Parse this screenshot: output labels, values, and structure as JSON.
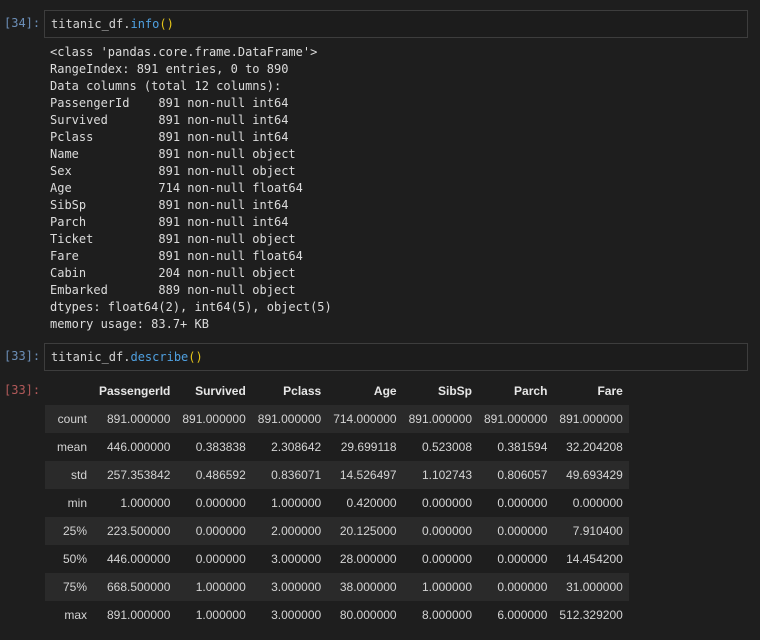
{
  "cells": [
    {
      "prompt": "[34]:",
      "code": {
        "object": "titanic_df",
        "method": "info",
        "args": "()"
      },
      "stdout": [
        "<class 'pandas.core.frame.DataFrame'>",
        "RangeIndex: 891 entries, 0 to 890",
        "Data columns (total 12 columns):",
        "PassengerId    891 non-null int64",
        "Survived       891 non-null int64",
        "Pclass         891 non-null int64",
        "Name           891 non-null object",
        "Sex            891 non-null object",
        "Age            714 non-null float64",
        "SibSp          891 non-null int64",
        "Parch          891 non-null int64",
        "Ticket         891 non-null object",
        "Fare           891 non-null float64",
        "Cabin          204 non-null object",
        "Embarked       889 non-null object",
        "dtypes: float64(2), int64(5), object(5)",
        "memory usage: 83.7+ KB"
      ]
    },
    {
      "prompt": "[33]:",
      "code": {
        "object": "titanic_df",
        "method": "describe",
        "args": "()"
      },
      "output_prompt": "[33]:"
    }
  ],
  "describe_table": {
    "columns": [
      "PassengerId",
      "Survived",
      "Pclass",
      "Age",
      "SibSp",
      "Parch",
      "Fare"
    ],
    "rows": [
      {
        "index": "count",
        "values": [
          "891.000000",
          "891.000000",
          "891.000000",
          "714.000000",
          "891.000000",
          "891.000000",
          "891.000000"
        ]
      },
      {
        "index": "mean",
        "values": [
          "446.000000",
          "0.383838",
          "2.308642",
          "29.699118",
          "0.523008",
          "0.381594",
          "32.204208"
        ]
      },
      {
        "index": "std",
        "values": [
          "257.353842",
          "0.486592",
          "0.836071",
          "14.526497",
          "1.102743",
          "0.806057",
          "49.693429"
        ]
      },
      {
        "index": "min",
        "values": [
          "1.000000",
          "0.000000",
          "1.000000",
          "0.420000",
          "0.000000",
          "0.000000",
          "0.000000"
        ]
      },
      {
        "index": "25%",
        "values": [
          "223.500000",
          "0.000000",
          "2.000000",
          "20.125000",
          "0.000000",
          "0.000000",
          "7.910400"
        ]
      },
      {
        "index": "50%",
        "values": [
          "446.000000",
          "0.000000",
          "3.000000",
          "28.000000",
          "0.000000",
          "0.000000",
          "14.454200"
        ]
      },
      {
        "index": "75%",
        "values": [
          "668.500000",
          "1.000000",
          "3.000000",
          "38.000000",
          "1.000000",
          "0.000000",
          "31.000000"
        ]
      },
      {
        "index": "max",
        "values": [
          "891.000000",
          "1.000000",
          "3.000000",
          "80.000000",
          "8.000000",
          "6.000000",
          "512.329200"
        ]
      }
    ]
  }
}
